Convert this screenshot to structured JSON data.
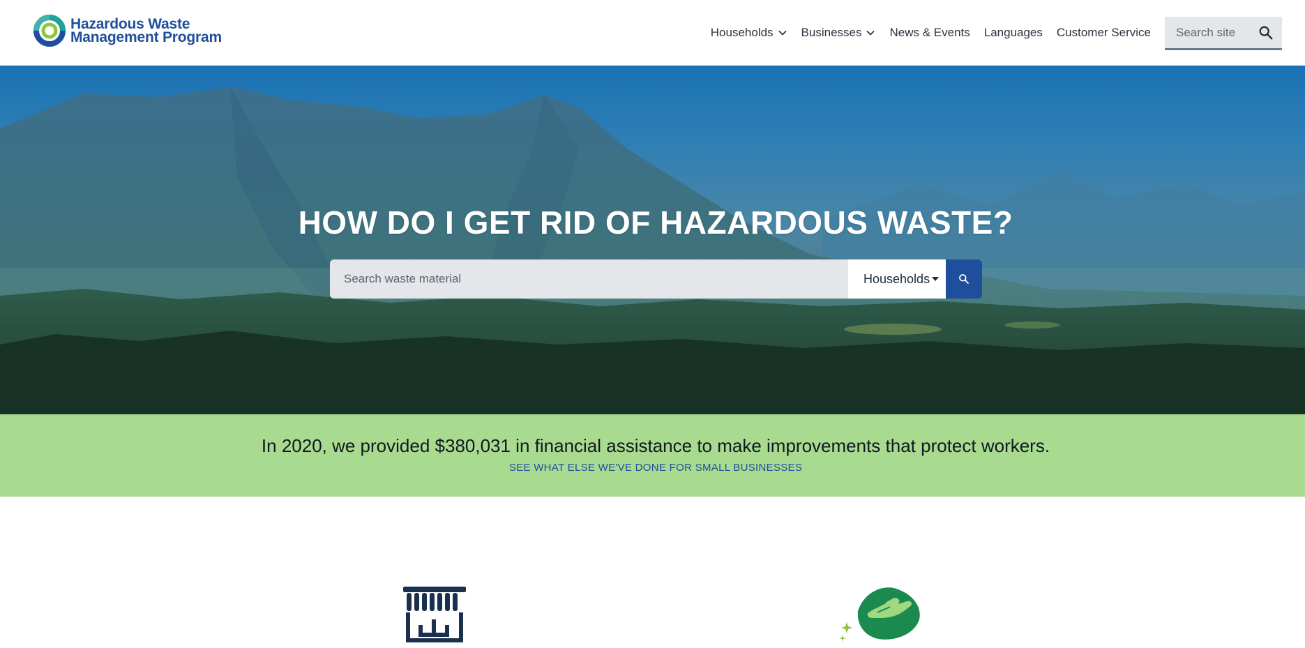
{
  "brand": {
    "name_line1": "Hazardous Waste",
    "name_line2": "Management Program",
    "logo_icon": "ring-logo-icon",
    "color_primary": "#1f4f9c",
    "color_accent": "#8cc63f"
  },
  "nav": {
    "items": [
      {
        "label": "Households",
        "has_dropdown": true
      },
      {
        "label": "Businesses",
        "has_dropdown": true
      },
      {
        "label": "News & Events",
        "has_dropdown": false
      },
      {
        "label": "Languages",
        "has_dropdown": false
      },
      {
        "label": "Customer Service",
        "has_dropdown": false
      }
    ],
    "search_placeholder": "Search site",
    "search_icon": "search-icon"
  },
  "hero": {
    "title": "HOW DO I GET RID OF HAZARDOUS WASTE?",
    "search_placeholder": "Search waste material",
    "audience_selected": "Households",
    "submit_icon": "search-icon"
  },
  "banner": {
    "text": "In 2020, we provided $380,031 in financial assistance to make improvements that protect workers.",
    "link_label": "SEE WHAT ELSE WE'VE DONE FOR SMALL BUSINESSES",
    "background": "#a8db8f"
  },
  "features": [
    {
      "icon": "storefront-icon"
    },
    {
      "icon": "hand-cleaning-icon"
    }
  ]
}
